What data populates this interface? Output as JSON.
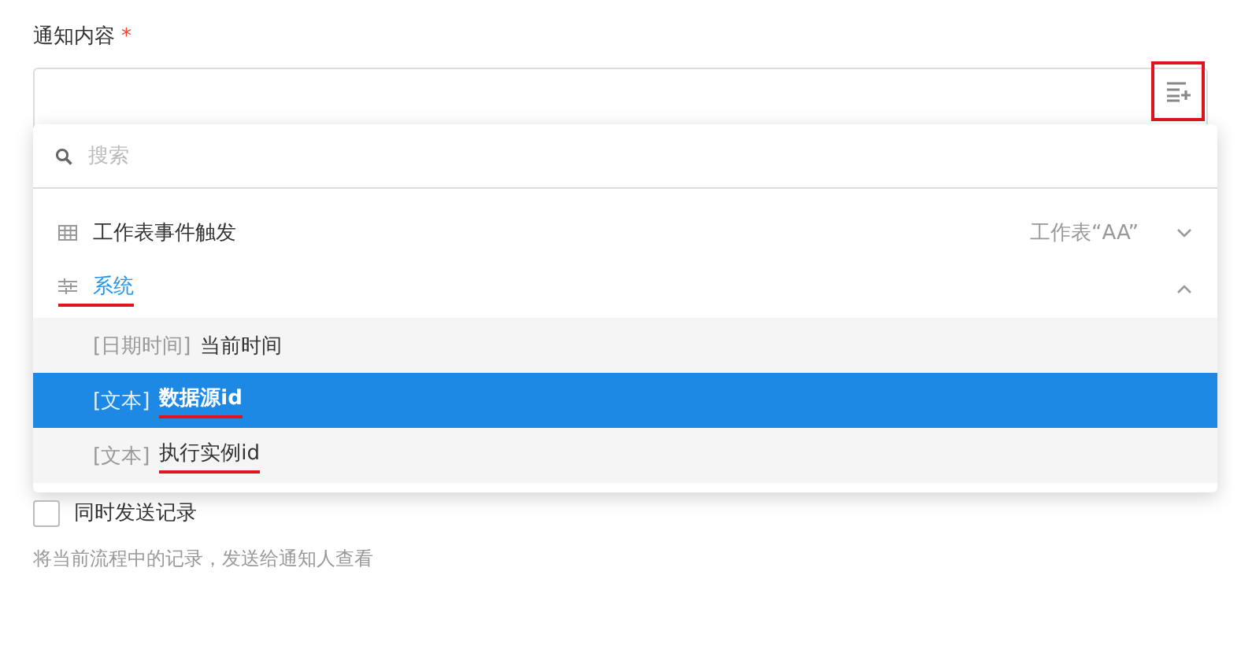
{
  "field": {
    "label": "通知内容",
    "required_mark": "*",
    "insert_button_annotated": true
  },
  "dropdown": {
    "search": {
      "placeholder": "搜索"
    },
    "groups": [
      {
        "kind": "table",
        "title": "工作表事件触发",
        "subtitle": "工作表“AA”",
        "expanded": false,
        "annotated": false
      },
      {
        "kind": "system",
        "title": "系统",
        "expanded": true,
        "annotated": true,
        "items": [
          {
            "type": "[日期时间]",
            "name": "当前时间",
            "selected": false,
            "annotated": false
          },
          {
            "type": "[文本]",
            "name": "数据源id",
            "selected": true,
            "annotated": true
          },
          {
            "type": "[文本]",
            "name": "执行实例id",
            "selected": false,
            "annotated": true
          }
        ]
      }
    ]
  },
  "send_record": {
    "label": "同时发送记录",
    "checked": false,
    "hint": "将当前流程中的记录，发送给通知人查看"
  }
}
